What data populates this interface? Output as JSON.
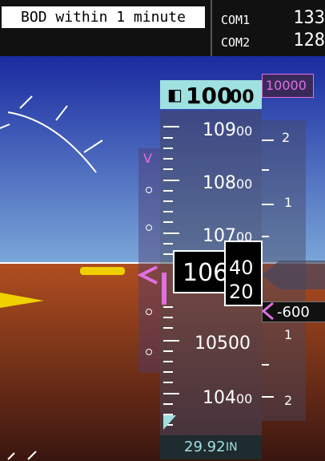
{
  "message": "BOD within 1 minute",
  "com": {
    "com1_label": "COM1",
    "com1_freq": "133",
    "com2_label": "COM2",
    "com2_freq": "128"
  },
  "altitude": {
    "selected_main": "100",
    "selected_small": "00",
    "vnav_target": "10000",
    "ticks": [
      {
        "main": "109",
        "small": "00"
      },
      {
        "main": "108",
        "small": "00"
      },
      {
        "main": "107",
        "small": "00"
      },
      {
        "main": "10500",
        "small": ""
      },
      {
        "main": "104",
        "small": "00"
      }
    ],
    "current_main": "106",
    "current_roll_upper": "40",
    "current_roll_lower": "20",
    "deviation_label": "V"
  },
  "vertical_speed": {
    "scale": [
      "2",
      "1",
      "1",
      "2"
    ],
    "required": "-600"
  },
  "baro": {
    "value": "29.92",
    "unit": "IN"
  },
  "colors": {
    "sky": "#1a2aa0",
    "ground": "#8a3a1a",
    "magenta": "#e070e0",
    "cyan": "#9fe0e0",
    "aircraft_symbol": "#f0d000"
  }
}
